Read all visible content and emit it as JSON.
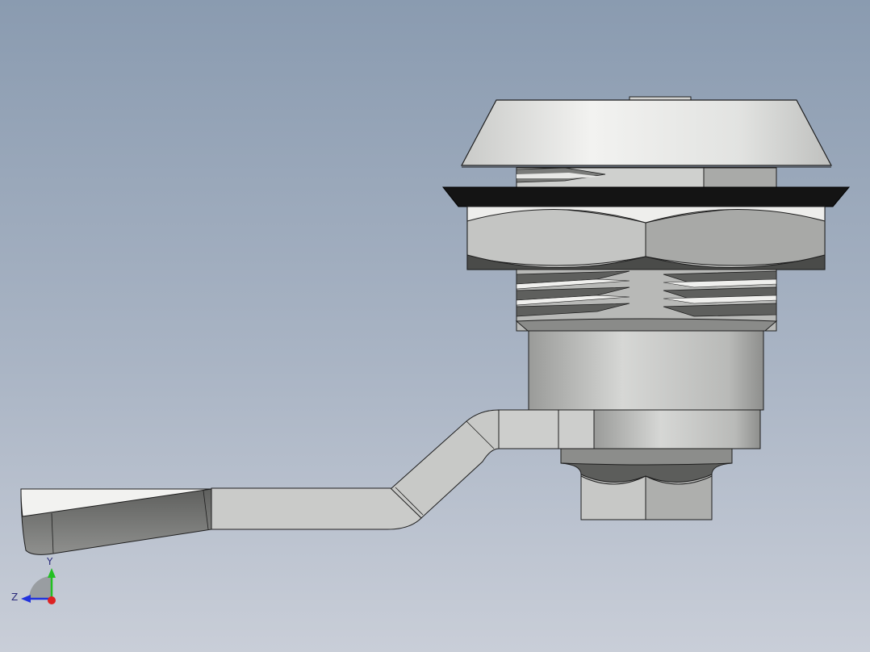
{
  "viewport": {
    "background_top": "#8a9bb0",
    "background_bottom": "#c9ced8"
  },
  "model": {
    "name": "cam lock",
    "parts": [
      "bezel-cap",
      "flange-washer",
      "hex-nut",
      "threaded-body",
      "cylinder-housing",
      "cam-arm",
      "retaining-nut"
    ],
    "colors": {
      "metal_light": "#e8e8e6",
      "metal_mid": "#c4c6c3",
      "metal_dark": "#6e6e6c",
      "washer": "#141414",
      "edge": "#1e1e1e"
    }
  },
  "triad": {
    "y_label": "Y",
    "z_label": "Z",
    "y_color": "#22c022",
    "z_color": "#2233dd",
    "x_color": "#dd2222"
  }
}
